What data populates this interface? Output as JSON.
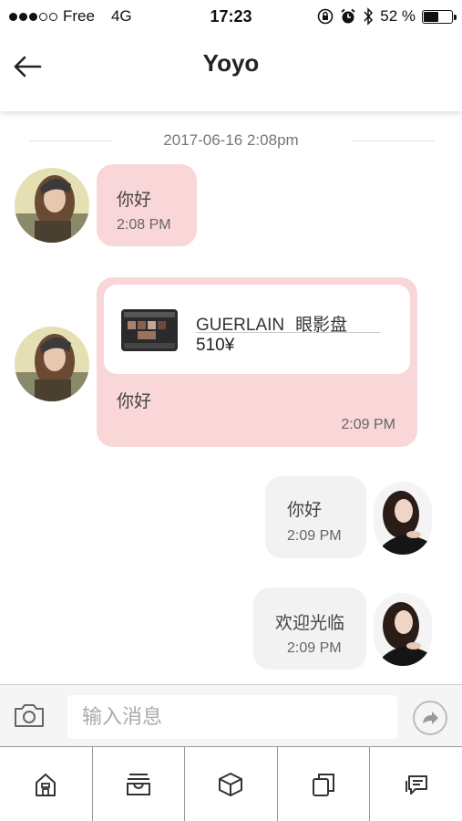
{
  "status_bar": {
    "carrier": "Free",
    "network": "4G",
    "time": "17:23",
    "battery_percent": "52 %",
    "battery_level": 0.52
  },
  "header": {
    "title": "Yoyo"
  },
  "chat": {
    "timestamp": "2017-06-16 2:08pm",
    "messages": [
      {
        "text": "你好",
        "time": "2:08 PM"
      },
      {
        "product_brand": "GUERLAIN",
        "product_name": "眼影盘",
        "product_price": "510¥",
        "text": "你好",
        "time": "2:09 PM"
      },
      {
        "text": "你好",
        "time": "2:09 PM"
      },
      {
        "text": "欢迎光临",
        "time": "2:09 PM"
      }
    ]
  },
  "input": {
    "placeholder": "输入消息"
  },
  "colors": {
    "incoming_bubble": "#f9d6d8",
    "outgoing_bubble": "#f2f2f2"
  },
  "tabs": [
    {
      "icon": "home-icon"
    },
    {
      "icon": "inbox-icon"
    },
    {
      "icon": "package-icon"
    },
    {
      "icon": "copy-icon"
    },
    {
      "icon": "chat-icon"
    }
  ]
}
